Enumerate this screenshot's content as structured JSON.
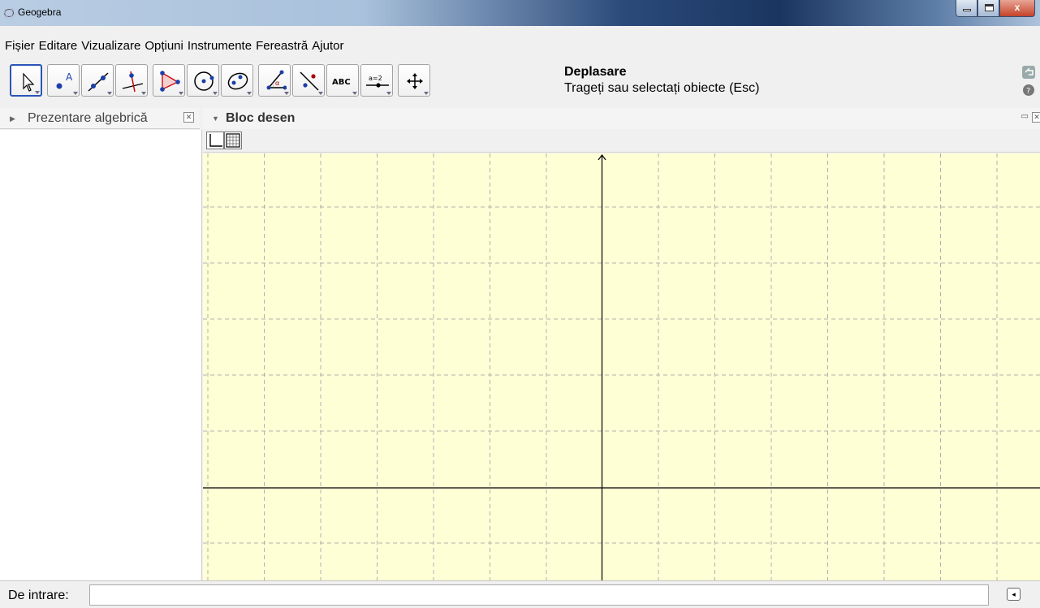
{
  "window": {
    "title": "Geogebra"
  },
  "menu": [
    "Fișier",
    "Editare",
    "Vizualizare",
    "Opțiuni",
    "Instrumente",
    "Fereastră",
    "Ajutor"
  ],
  "tool_help": {
    "name": "Deplasare",
    "desc": "Trageți sau selectați obiecte (Esc)"
  },
  "tools": [
    {
      "icon": "move-arrow-icon"
    },
    {
      "icon": "point-icon"
    },
    {
      "icon": "line-icon"
    },
    {
      "icon": "perpendicular-line-icon"
    },
    {
      "icon": "polygon-icon"
    },
    {
      "icon": "circle-icon"
    },
    {
      "icon": "ellipse-icon"
    },
    {
      "icon": "angle-icon"
    },
    {
      "icon": "reflect-icon"
    },
    {
      "icon": "text-icon",
      "label": "ABC"
    },
    {
      "icon": "slider-icon",
      "label": "a=2"
    },
    {
      "icon": "move-graphics-icon"
    }
  ],
  "algebra_panel": {
    "title": "Prezentare algebrică"
  },
  "graphics_panel": {
    "title": "Bloc desen"
  },
  "input_bar": {
    "label": "De intrare:",
    "value": ""
  },
  "colors": {
    "canvas": "#ffffd6",
    "grid": "#b0b0b0",
    "axes": "#000000",
    "active_tool": "#2a55b8"
  }
}
